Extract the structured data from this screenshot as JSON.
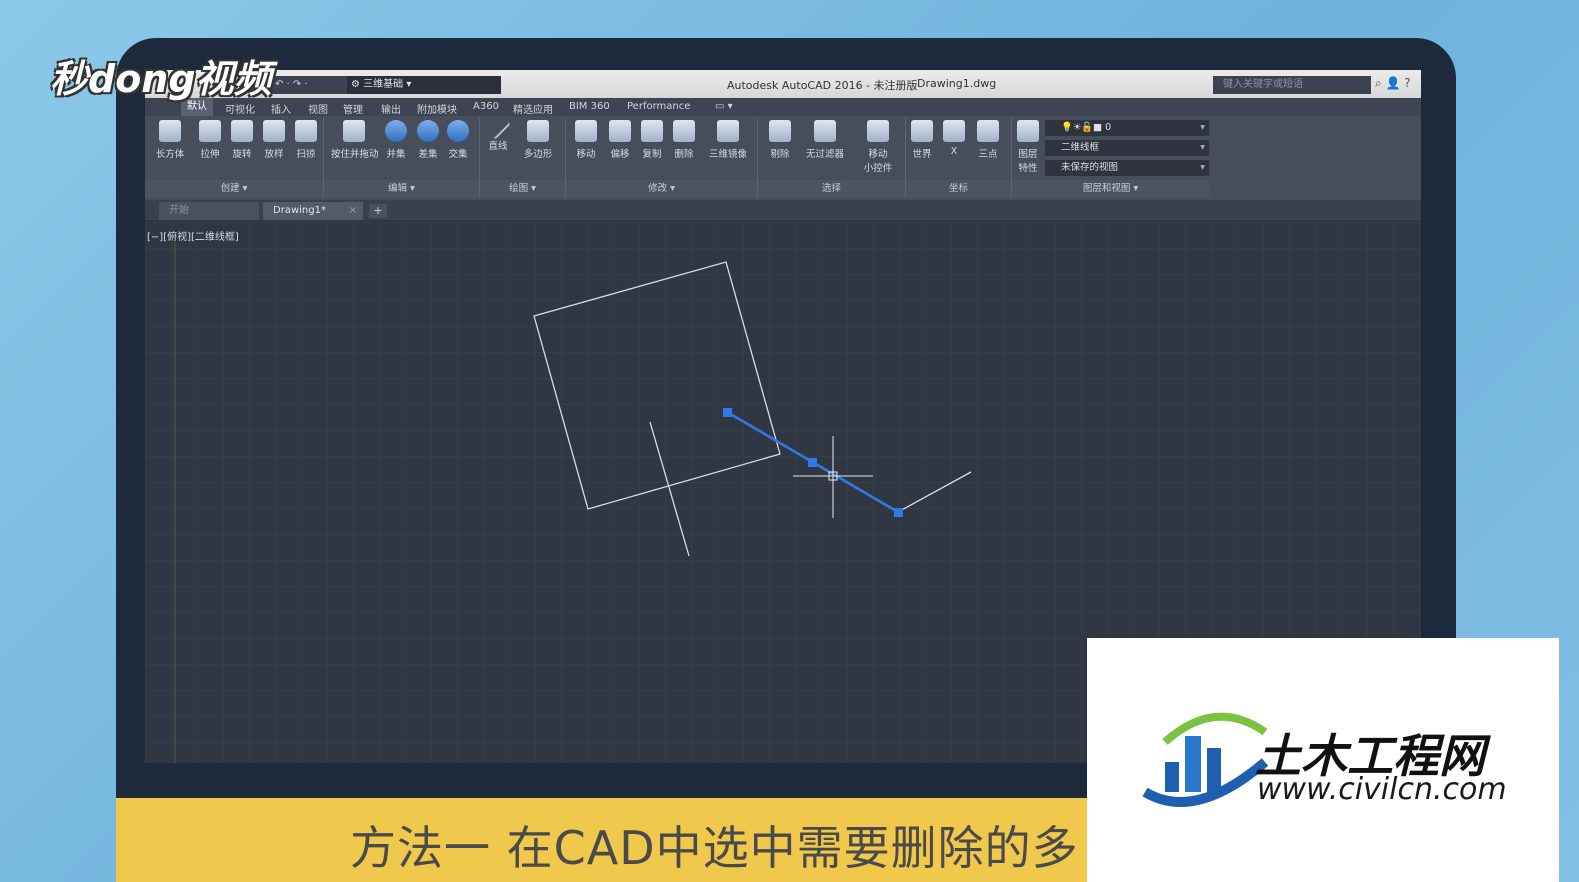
{
  "watermark": "秒dong视频",
  "titlebar": {
    "workspace": "三维基础",
    "title": "Autodesk AutoCAD 2016 - 未注册版",
    "file": "Drawing1.dwg",
    "search_placeholder": "键入关键字或短语"
  },
  "ribbon_tabs": [
    "默认",
    "可视化",
    "插入",
    "视图",
    "管理",
    "输出",
    "附加模块",
    "A360",
    "精选应用",
    "BIM 360",
    "Performance"
  ],
  "ribbon_buttons": {
    "box": "长方体",
    "extrude": "拉伸",
    "revolve": "旋转",
    "loft": "放样",
    "sweep": "扫掠",
    "presspull": "按住并拖动",
    "union": "并集",
    "subtract": "差集",
    "intersect": "交集",
    "line": "直线",
    "polygon": "多边形",
    "move": "移动",
    "offset": "偏移",
    "copy": "复制",
    "erase": "删除",
    "mirror3d": "三维镜像",
    "cull": "剔除",
    "nofilter": "无过滤器",
    "gizmo_line1": "移动",
    "gizmo_line2": "小控件",
    "world": "世界",
    "x": "X",
    "threepoint": "三点",
    "layer_props_line1": "图层",
    "layer_props_line2": "特性"
  },
  "panels": {
    "create": "创建",
    "edit": "编辑",
    "draw": "绘图",
    "modify": "修改",
    "selection": "选择",
    "coordinates": "坐标",
    "layers_views": "图层和视图"
  },
  "layers": {
    "current_layer": "0",
    "visual_style": "二维线框",
    "named_view": "未保存的视图"
  },
  "doc_tabs": {
    "start": "开始",
    "drawing": "Drawing1*"
  },
  "viewport_label": "[−][俯视][二维线框]",
  "caption": "方法一 在CAD中选中需要删除的多",
  "logo": {
    "cn": "土木工程网",
    "url": "www.civilcn.com"
  },
  "colors": {
    "selection_blue": "#2f7be5",
    "canvas": "#303743",
    "caption_bg": "#f0c84c"
  }
}
